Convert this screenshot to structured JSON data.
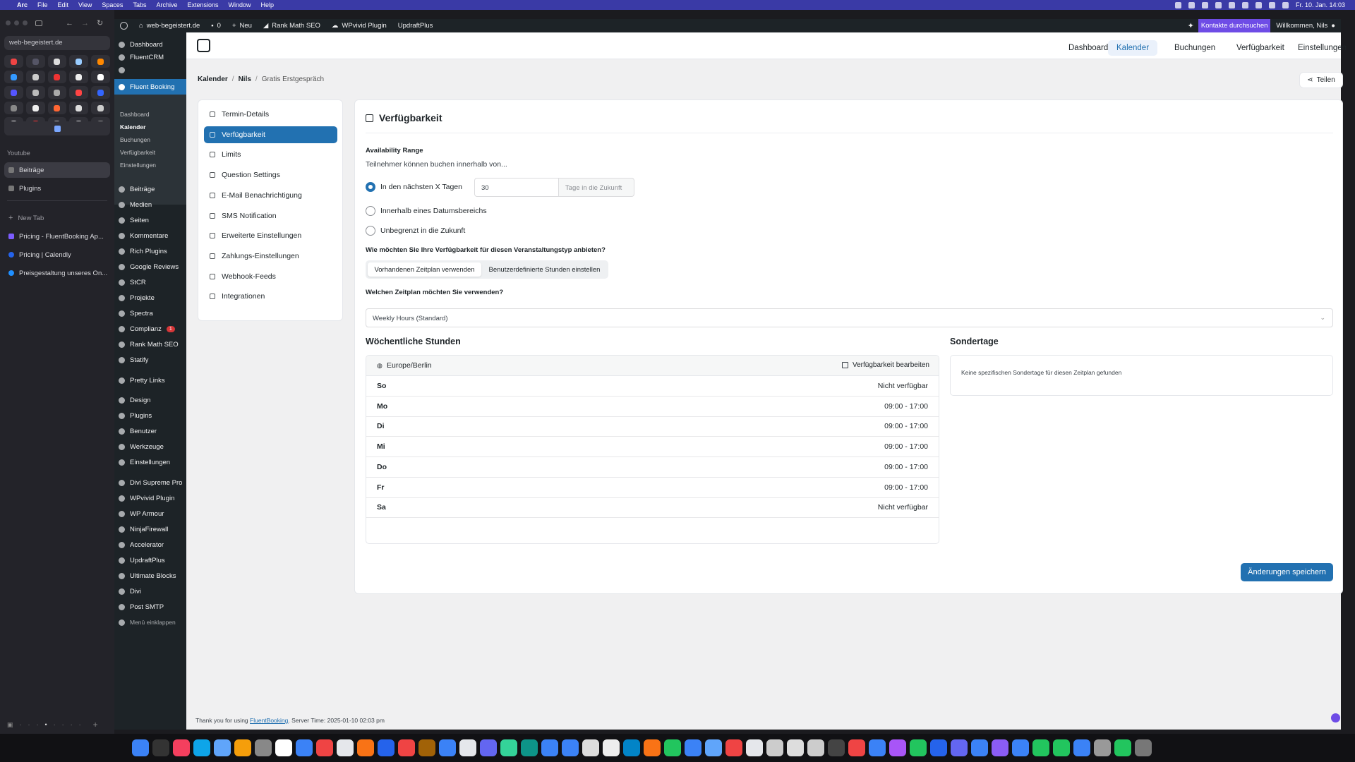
{
  "menubar": {
    "app": "Arc",
    "items": [
      "File",
      "Edit",
      "View",
      "Spaces",
      "Tabs",
      "Archive",
      "Extensions",
      "Window",
      "Help"
    ],
    "clock": "Fr. 10. Jan.  14:03"
  },
  "arc": {
    "url": "web-begeistert.de",
    "section_label": "Youtube",
    "pinned_tabs": [
      "Beiträge",
      "Plugins"
    ],
    "new_tab": "New Tab",
    "tabs": [
      "Pricing - FluentBooking Ap...",
      "Pricing | Calendly",
      "Preisgestaltung unseres On..."
    ],
    "fav_colors": [
      "#e44",
      "#556",
      "#ddd",
      "#9cf",
      "#f80",
      "#39f",
      "#ccc",
      "#e33",
      "#eee",
      "#fff",
      "#55f",
      "#bbb",
      "#aaa",
      "#f44",
      "#36f",
      "#888",
      "#eee",
      "#f63",
      "#ddd",
      "#ccc",
      "#eee",
      "#f33",
      "#bbb",
      "#ddd",
      "#999",
      "#e33"
    ]
  },
  "adminbar": {
    "site": "web-begeistert.de",
    "comments": "0",
    "new": "Neu",
    "rankmath": "Rank Math SEO",
    "wpvivid": "WPvivid Plugin",
    "updraft": "UpdraftPlus",
    "contacts": "Kontakte durchsuchen",
    "welcome": "Willkommen, Nils"
  },
  "wpmenu": {
    "top": [
      "Dashboard",
      "FluentCRM"
    ],
    "current": "Fluent Booking",
    "submenu": [
      "Dashboard",
      "Kalender",
      "Buchungen",
      "Verfügbarkeit",
      "Einstellungen"
    ],
    "items": [
      "Beiträge",
      "Medien",
      "Seiten",
      "Kommentare",
      "Rich Plugins",
      "Google Reviews",
      "StCR",
      "Projekte",
      "Spectra",
      "Complianz",
      "Rank Math SEO",
      "Statify",
      "Pretty Links",
      "Design",
      "Plugins",
      "Benutzer",
      "Werkzeuge",
      "Einstellungen",
      "Divi Supreme Pro",
      "WPvivid Plugin",
      "WP Armour",
      "NinjaFirewall",
      "Accelerator",
      "UpdraftPlus",
      "Ultimate Blocks",
      "Divi",
      "Post SMTP",
      "Menü einklappen"
    ],
    "complianz_badge": "1"
  },
  "topnav": [
    "Dashboard",
    "Kalender",
    "Buchungen",
    "Verfügbarkeit",
    "Einstellungen"
  ],
  "breadcrumb": {
    "a": "Kalender",
    "sep": "/",
    "b": "Nils",
    "c": "Gratis Erstgespräch"
  },
  "share_label": "Teilen",
  "sidenav": [
    "Termin-Details",
    "Verfügbarkeit",
    "Limits",
    "Question Settings",
    "E-Mail Benachrichtigung",
    "SMS Notification",
    "Erweiterte Einstellungen",
    "Zahlungs-Einstellungen",
    "Webhook-Feeds",
    "Integrationen"
  ],
  "panel": {
    "title": "Verfügbarkeit",
    "range_label": "Availability Range",
    "range_sub": "Teilnehmer können buchen innerhalb von...",
    "opt1": "In den nächsten X Tagen",
    "days_value": "30",
    "days_suffix": "Tage in die Zukunft",
    "opt2": "Innerhalb eines Datumsbereichs",
    "opt3": "Unbegrenzt in die Zukunft",
    "q1": "Wie möchten Sie Ihre Verfügbarkeit für diesen Veranstaltungstyp anbieten?",
    "seg1": "Vorhandenen Zeitplan verwenden",
    "seg2": "Benutzerdefinierte Stunden einstellen",
    "q2": "Welchen Zeitplan möchten Sie verwenden?",
    "schedule": "Weekly Hours (Standard)",
    "weekly_title": "Wöchentliche Stunden",
    "timezone": "Europe/Berlin",
    "edit": "Verfügbarkeit bearbeiten",
    "days": [
      {
        "d": "So",
        "t": "Nicht verfügbar"
      },
      {
        "d": "Mo",
        "t": "09:00 - 17:00"
      },
      {
        "d": "Di",
        "t": "09:00 - 17:00"
      },
      {
        "d": "Mi",
        "t": "09:00 - 17:00"
      },
      {
        "d": "Do",
        "t": "09:00 - 17:00"
      },
      {
        "d": "Fr",
        "t": "09:00 - 17:00"
      },
      {
        "d": "Sa",
        "t": "Nicht verfügbar"
      }
    ],
    "special_title": "Sondertage",
    "special_empty": "Keine spezifischen Sondertage für diesen Zeitplan gefunden",
    "save": "Änderungen speichern"
  },
  "footer": {
    "pre": "Thank you for using",
    "link": "FluentBooking",
    "post": ".  Server Time: 2025-01-10 02:03 pm"
  },
  "dock_colors": [
    "#3b82f6",
    "#333",
    "#f43f5e",
    "#0ea5e9",
    "#60a5fa",
    "#f59e0b",
    "#888",
    "#fff",
    "#3b82f6",
    "#ef4444",
    "#e5e7eb",
    "#f97316",
    "#2563eb",
    "#ef4444",
    "#a16207",
    "#3b82f6",
    "#e5e7eb",
    "#6366f1",
    "#34d399",
    "#0d9488",
    "#3b82f6",
    "#3b82f6",
    "#ddd",
    "#eee",
    "#0284c7",
    "#f97316",
    "#22c55e",
    "#3b82f6",
    "#60a5fa",
    "#ef4444",
    "#e5e7eb",
    "#ccc",
    "#ddd",
    "#ccc",
    "#444",
    "#ef4444",
    "#3b82f6",
    "#a855f7",
    "#22c55e",
    "#2563eb",
    "#6366f1",
    "#3b82f6",
    "#8b5cf6",
    "#3b82f6",
    "#22c55e",
    "#22c55e",
    "#3b82f6",
    "#999",
    "#22c55e",
    "#777"
  ]
}
